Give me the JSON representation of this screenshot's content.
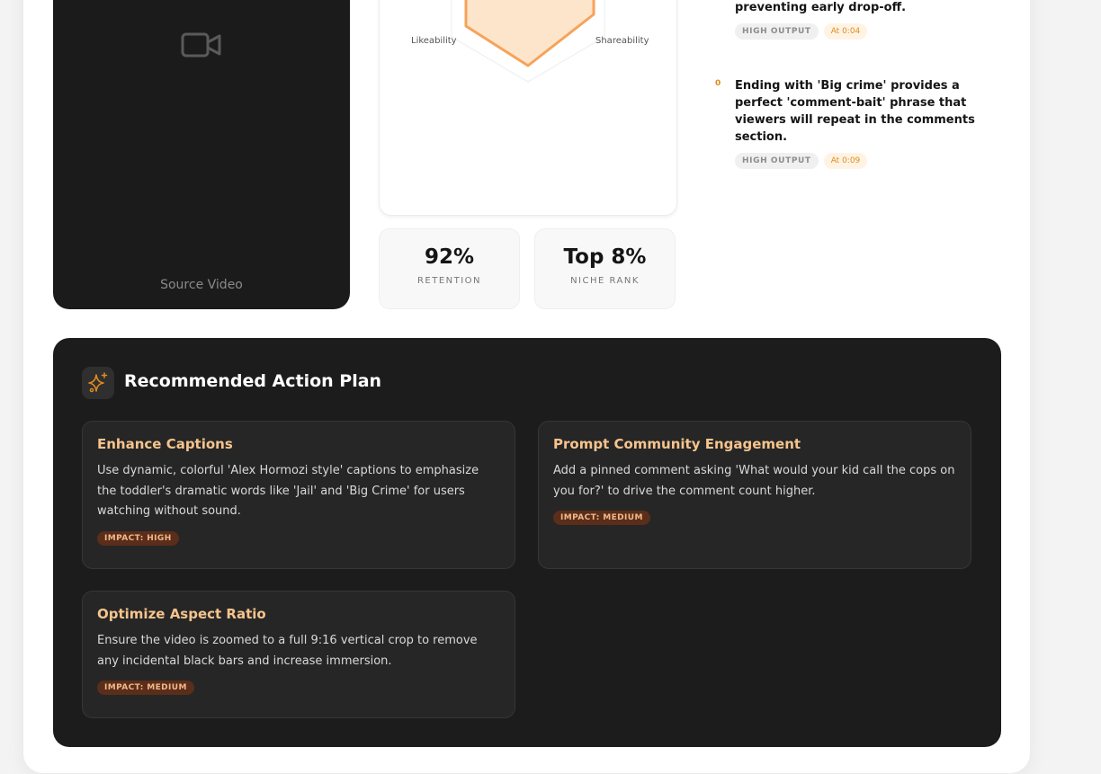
{
  "video": {
    "icon": "video-camera-icon",
    "label": "Source Video"
  },
  "radar": {
    "axis_left": "Likeability",
    "axis_right": "Shareability",
    "colors": {
      "fill": "#fde5cc",
      "stroke": "#f6a35a"
    }
  },
  "stats": [
    {
      "value": "92%",
      "label": "RETENTION"
    },
    {
      "value": "Top 8%",
      "label": "NICHE RANK"
    }
  ],
  "insights": [
    {
      "number": "",
      "text": "preventing early drop-off.",
      "output_tag": "HIGH OUTPUT",
      "time_tag": "At 0:04"
    },
    {
      "number": "0",
      "text": "Ending with 'Big crime' provides a perfect 'comment-bait' phrase that viewers will repeat in the comments section.",
      "output_tag": "HIGH OUTPUT",
      "time_tag": "At 0:09"
    }
  ],
  "action_plan": {
    "icon": "sparkle-icon",
    "title": "Recommended Action Plan",
    "accent": "#f6c48d",
    "cards": [
      {
        "title": "Enhance Captions",
        "description": "Use dynamic, colorful 'Alex Hormozi style' captions to emphasize the toddler's dramatic words like 'Jail' and 'Big Crime' for users watching without sound.",
        "impact": "IMPACT: HIGH"
      },
      {
        "title": "Prompt Community Engagement",
        "description": "Add a pinned comment asking 'What would your kid call the cops on you for?' to drive the comment count higher.",
        "impact": "IMPACT: MEDIUM"
      },
      {
        "title": "Optimize Aspect Ratio",
        "description": "Ensure the video is zoomed to a full 9:16 vertical crop to remove any incidental black bars and increase immersion.",
        "impact": "IMPACT: MEDIUM"
      }
    ]
  }
}
